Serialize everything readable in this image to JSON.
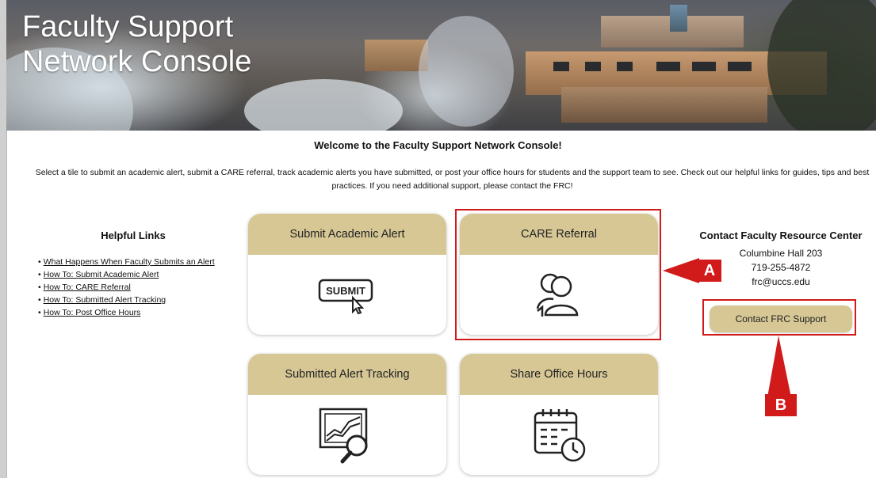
{
  "banner": {
    "title_line1": "Faculty Support",
    "title_line2": "Network Console"
  },
  "welcome": {
    "heading": "Welcome to the Faculty Support Network Console!",
    "intro": "Select a tile to submit an academic alert, submit a CARE referral, track academic alerts you have submitted, or post your office hours for students and the support team to see. Check out our helpful links for guides, tips and best practices. If you need additional support, please contact the FRC!"
  },
  "helpful_links": {
    "title": "Helpful Links",
    "items": [
      {
        "label": "What Happens When Faculty Submits an Alert"
      },
      {
        "label": "How To: Submit Academic Alert"
      },
      {
        "label": "How To: CARE Referral"
      },
      {
        "label": "How To: Submitted Alert Tracking"
      },
      {
        "label": "How To: Post Office Hours"
      }
    ]
  },
  "tiles": [
    {
      "label": "Submit Academic Alert",
      "icon": "submit-icon",
      "icon_text": "SUBMIT"
    },
    {
      "label": "CARE Referral",
      "icon": "care-referral-icon"
    },
    {
      "label": "Submitted Alert Tracking",
      "icon": "alert-tracking-icon"
    },
    {
      "label": "Share Office Hours",
      "icon": "calendar-clock-icon"
    }
  ],
  "contact": {
    "title": "Contact Faculty Resource Center",
    "location": "Columbine Hall 203",
    "phone": "719-255-4872",
    "email": "frc@uccs.edu",
    "button_label": "Contact FRC Support"
  },
  "annotations": {
    "a_label": "A",
    "b_label": "B",
    "color": "#d11a1a"
  },
  "colors": {
    "tile_header": "#d7c795",
    "text": "#111111"
  }
}
